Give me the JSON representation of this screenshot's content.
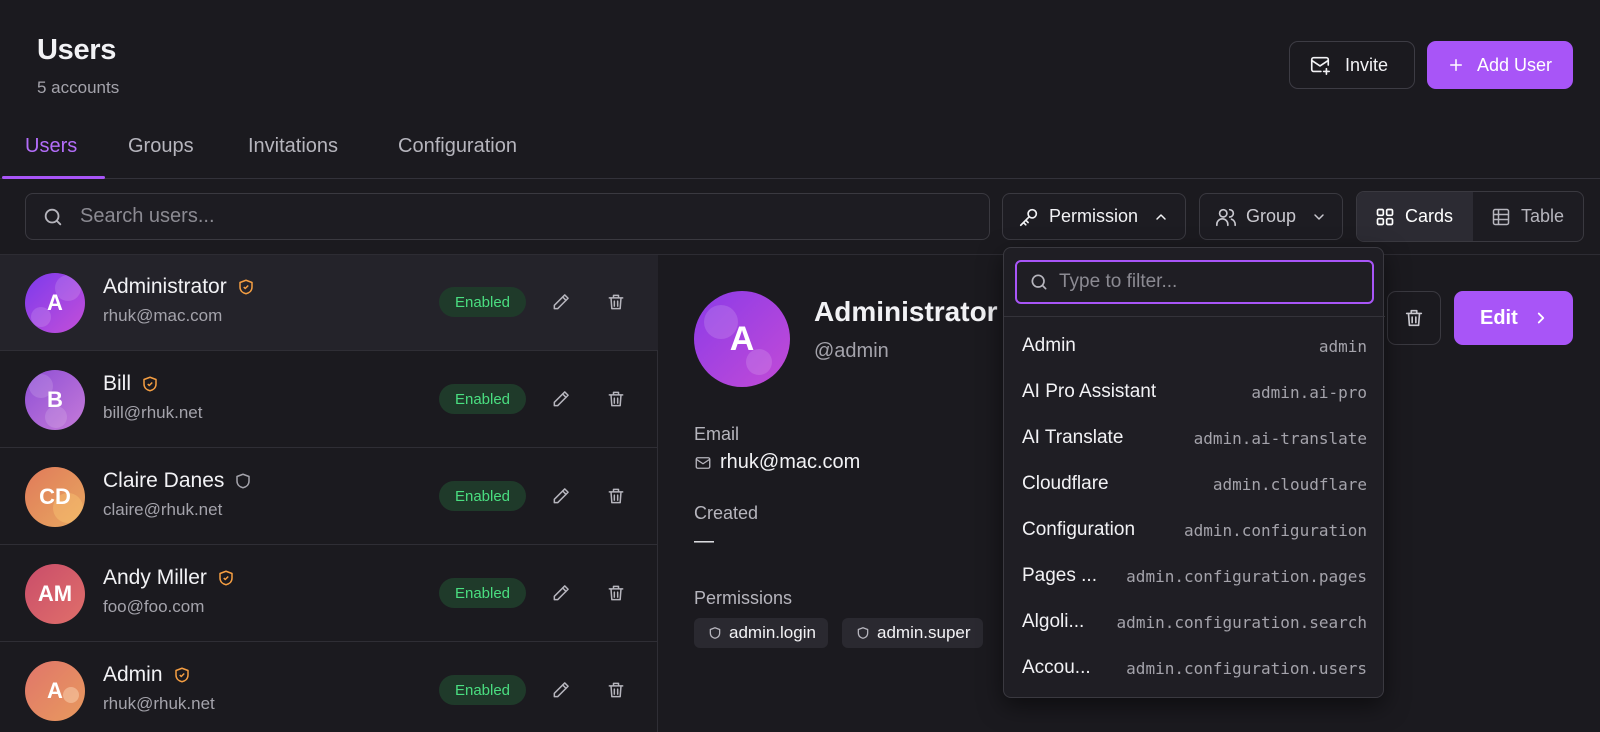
{
  "header": {
    "title": "Users",
    "subtitle": "5 accounts",
    "invite_label": "Invite",
    "add_label": "Add User"
  },
  "tabs": [
    {
      "label": "Users",
      "active": true
    },
    {
      "label": "Groups"
    },
    {
      "label": "Invitations"
    },
    {
      "label": "Configuration"
    }
  ],
  "toolbar": {
    "search_placeholder": "Search users...",
    "permission_label": "Permission",
    "group_label": "Group",
    "view_cards": "Cards",
    "view_table": "Table"
  },
  "users": [
    {
      "initials": "A",
      "name": "Administrator",
      "email": "rhuk@mac.com",
      "status": "Enabled",
      "shield": "orange",
      "selected": true
    },
    {
      "initials": "B",
      "name": "Bill",
      "email": "bill@rhuk.net",
      "status": "Enabled",
      "shield": "orange"
    },
    {
      "initials": "CD",
      "name": "Claire Danes",
      "email": "claire@rhuk.net",
      "status": "Enabled",
      "shield": "gray"
    },
    {
      "initials": "AM",
      "name": "Andy Miller",
      "email": "foo@foo.com",
      "status": "Enabled",
      "shield": "orange"
    },
    {
      "initials": "A",
      "name": "Admin",
      "email": "rhuk@rhuk.net",
      "status": "Enabled",
      "shield": "orange"
    }
  ],
  "detail": {
    "initials": "A",
    "name": "Administrator",
    "handle": "@admin",
    "email_label": "Email",
    "email": "rhuk@mac.com",
    "created_label": "Created",
    "created": "—",
    "permissions_label": "Permissions",
    "permissions": [
      "admin.login",
      "admin.super"
    ],
    "edit_label": "Edit"
  },
  "dropdown": {
    "filter_placeholder": "Type to filter...",
    "items": [
      {
        "label": "Admin",
        "key": "admin"
      },
      {
        "label": "AI Pro Assistant",
        "key": "admin.ai-pro"
      },
      {
        "label": "AI Translate",
        "key": "admin.ai-translate"
      },
      {
        "label": "Cloudflare",
        "key": "admin.cloudflare"
      },
      {
        "label": "Configuration",
        "key": "admin.configuration"
      },
      {
        "label": "Pages ...",
        "key": "admin.configuration.pages"
      },
      {
        "label": "Algoli...",
        "key": "admin.configuration.search"
      },
      {
        "label": "Accou...",
        "key": "admin.configuration.users"
      }
    ]
  },
  "colors": {
    "accent": "#a855f7",
    "background": "#1b1a1f",
    "enabled_text": "#4ade80",
    "enabled_bg": "#1f3a2a",
    "shield_orange": "#f59e42",
    "shield_gray": "#a4a3ab"
  },
  "icons": {
    "invite": "mail-plus-icon",
    "add": "plus-icon",
    "search": "search-icon",
    "permission": "key-icon",
    "group": "users-icon",
    "cards": "grid-icon",
    "table": "table-icon",
    "edit": "pencil-icon",
    "delete": "trash-icon",
    "shield": "shield-icon",
    "email": "mail-icon",
    "chevron_up": "chevron-up-icon",
    "chevron_down": "chevron-down-icon",
    "chevron_right": "chevron-right-icon"
  }
}
